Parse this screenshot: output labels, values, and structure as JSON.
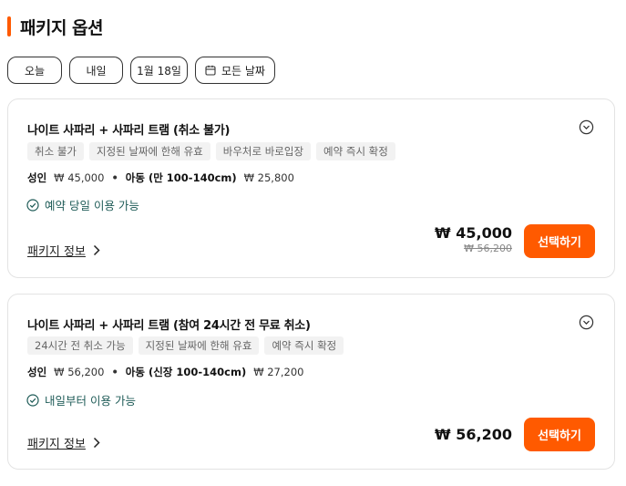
{
  "section": {
    "title": "패키지 옵션"
  },
  "date_chips": [
    {
      "label": "오늘"
    },
    {
      "label": "내일"
    },
    {
      "label": "1월 18일"
    },
    {
      "label": "모든 날짜",
      "icon": "calendar-icon"
    }
  ],
  "packages": [
    {
      "title": "나이트 사파리 + 사파리 트램 (취소 불가)",
      "tags": [
        "취소 불가",
        "지정된 날짜에 한해 유효",
        "바우처로 바로입장",
        "예약 즉시 확정"
      ],
      "adult_label": "성인",
      "adult_price": "₩ 45,000",
      "child_label": "아동 (만 100-140cm)",
      "child_price": "₩ 25,800",
      "availability": "예약 당일 이용 가능",
      "info_label": "패키지 정보",
      "price": "₩ 45,000",
      "original_price": "₩ 56,200",
      "button_label": "선택하기"
    },
    {
      "title": "나이트 사파리 + 사파리 트램 (참여 24시간 전 무료 취소)",
      "tags": [
        "24시간 전 취소 가능",
        "지정된 날짜에 한해 유효",
        "예약 즉시 확정"
      ],
      "adult_label": "성인",
      "adult_price": "₩ 56,200",
      "child_label": "아동 (신장 100-140cm)",
      "child_price": "₩ 27,200",
      "availability": "내일부터 이용 가능",
      "info_label": "패키지 정보",
      "price": "₩ 56,200",
      "button_label": "선택하기"
    }
  ],
  "colors": {
    "accent": "#ff5a00",
    "availability": "#1e5b57"
  }
}
